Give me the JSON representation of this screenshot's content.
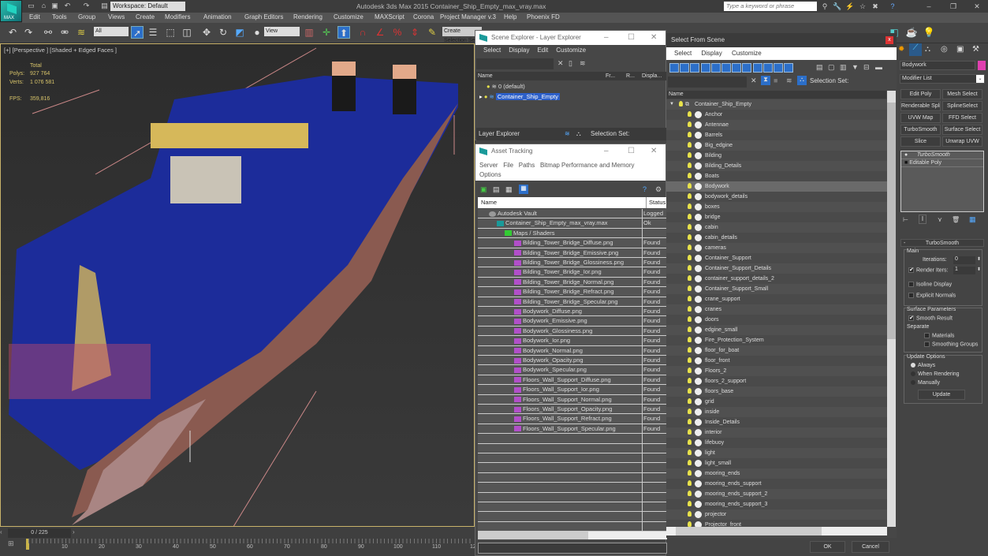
{
  "app": {
    "title": "Autodesk 3ds Max  2015     Container_Ship_Empty_max_vray.max",
    "logo_label": "MAX",
    "workspace": "Workspace: Default",
    "search_placeholder": "Type a keyword or phrase"
  },
  "menu": [
    "Edit",
    "Tools",
    "Group",
    "Views",
    "Create",
    "Modifiers",
    "Animation",
    "Graph Editors",
    "Rendering",
    "Customize",
    "MAXScript",
    "Corona",
    "Project Manager v.3",
    "Help",
    "Phoenix FD"
  ],
  "toolbar": {
    "filter": "All",
    "ref_coord": "View",
    "named_selection": "Create Selection Set"
  },
  "viewport": {
    "label": "[+] [Perspective ] [Shaded + Edged Faces ]",
    "stats_header": "Total",
    "polys_label": "Polys:",
    "polys_value": "927 764",
    "verts_label": "Verts:",
    "verts_value": "1 076 581",
    "fps_label": "FPS:",
    "fps_value": "359,816"
  },
  "timeline": {
    "frame": "0 / 225",
    "ticks": [
      "10",
      "20",
      "30",
      "40",
      "50",
      "60",
      "70",
      "80",
      "90",
      "100",
      "110",
      "12"
    ]
  },
  "scene_explorer": {
    "title": "Scene Explorer - Layer Explorer",
    "menu": [
      "Select",
      "Display",
      "Edit",
      "Customize"
    ],
    "columns": [
      "Name",
      "Fr...",
      "R...",
      "Displa..."
    ],
    "rows": [
      "0 (default)",
      "Container_Ship_Empty"
    ],
    "footer_mode": "Layer Explorer",
    "selection_set_label": "Selection Set:"
  },
  "asset_tracking": {
    "title": "Asset Tracking",
    "menu": [
      "Server",
      "File",
      "Paths",
      "Bitmap Performance and Memory",
      "Options"
    ],
    "columns": [
      "Name",
      "Status"
    ],
    "rows": [
      {
        "name": "Autodesk Vault",
        "status": "Logged"
      },
      {
        "name": "Container_Ship_Empty_max_vray.max",
        "status": "Ok"
      },
      {
        "name": "Maps / Shaders",
        "status": ""
      },
      {
        "name": "Bilding_Tower_Bridge_Diffuse.png",
        "status": "Found"
      },
      {
        "name": "Bilding_Tower_Bridge_Emissive.png",
        "status": "Found"
      },
      {
        "name": "Bilding_Tower_Bridge_Glossiness.png",
        "status": "Found"
      },
      {
        "name": "Bilding_Tower_Bridge_Ior.png",
        "status": "Found"
      },
      {
        "name": "Bilding_Tower_Bridge_Normal.png",
        "status": "Found"
      },
      {
        "name": "Bilding_Tower_Bridge_Refract.png",
        "status": "Found"
      },
      {
        "name": "Bilding_Tower_Bridge_Specular.png",
        "status": "Found"
      },
      {
        "name": "Bodywork_Diffuse.png",
        "status": "Found"
      },
      {
        "name": "Bodywork_Emissive.png",
        "status": "Found"
      },
      {
        "name": "Bodywork_Glossiness.png",
        "status": "Found"
      },
      {
        "name": "Bodywork_Ior.png",
        "status": "Found"
      },
      {
        "name": "Bodywork_Normal.png",
        "status": "Found"
      },
      {
        "name": "Bodywork_Opacity.png",
        "status": "Found"
      },
      {
        "name": "Bodywork_Specular.png",
        "status": "Found"
      },
      {
        "name": "Floors_Wall_Support_Diffuse.png",
        "status": "Found"
      },
      {
        "name": "Floors_Wall_Support_Ior.png",
        "status": "Found"
      },
      {
        "name": "Floors_Wall_Support_Normal.png",
        "status": "Found"
      },
      {
        "name": "Floors_Wall_Support_Opacity.png",
        "status": "Found"
      },
      {
        "name": "Floors_Wall_Support_Refract.png",
        "status": "Found"
      },
      {
        "name": "Floors_Wall_Support_Specular.png",
        "status": "Found"
      }
    ]
  },
  "select_from_scene": {
    "title": "Select From Scene",
    "menu": [
      "Select",
      "Display",
      "Customize"
    ],
    "selection_set_label": "Selection Set:",
    "column": "Name",
    "root": "Container_Ship_Empty",
    "selected": "Bodywork",
    "objects": [
      "Anchor",
      "Antennae",
      "Barrels",
      "Big_edgine",
      "Bilding",
      "Bilding_Details",
      "Boats",
      "Bodywork",
      "bodywork_details",
      "boxes",
      "bridge",
      "cabin",
      "cabin_details",
      "cameras",
      "Container_Support",
      "Container_Support_Details",
      "container_support_details_2",
      "Container_Support_Small",
      "crane_support",
      "cranes",
      "doors",
      "edgine_small",
      "Fire_Protection_System",
      "floor_for_boat",
      "floor_front",
      "Floors_2",
      "floors_2_support",
      "floors_base",
      "grid",
      "inside",
      "Inside_Details",
      "interior",
      "lifebuoy",
      "light",
      "light_small",
      "mooring_ends",
      "mooring_ends_support",
      "mooring_ends_support_2",
      "mooring_ends_support_3",
      "projector",
      "Projector_front"
    ],
    "ok": "OK",
    "cancel": "Cancel"
  },
  "command_panel": {
    "object_name": "Bodywork",
    "object_color": "#e040b0",
    "modifier_list": "Modifier List",
    "modifier_buttons": [
      "Edit Poly",
      "Mesh Select",
      "Renderable Spline",
      "SplineSelect",
      "UVW Map",
      "FFD Select",
      "TurboSmooth",
      "Surface Select",
      "Slice",
      "Unwrap UVW"
    ],
    "stack": [
      "TurboSmooth",
      "Editable Poly"
    ],
    "rollout_title": "TurboSmooth",
    "main_group": "Main",
    "iterations_label": "Iterations:",
    "iterations_value": "0",
    "render_iters_label": "Render Iters:",
    "render_iters_value": "1",
    "render_iters_checked": true,
    "isoline_label": "Isoline Display",
    "explicit_normals_label": "Explicit Normals",
    "surface_group": "Surface Parameters",
    "smooth_result_label": "Smooth Result",
    "separate_label": "Separate",
    "materials_label": "Materials",
    "smoothing_groups_label": "Smoothing Groups",
    "update_group": "Update Options",
    "update_options": [
      "Always",
      "When Rendering",
      "Manually"
    ],
    "update_selected": "Always",
    "update_button": "Update"
  }
}
